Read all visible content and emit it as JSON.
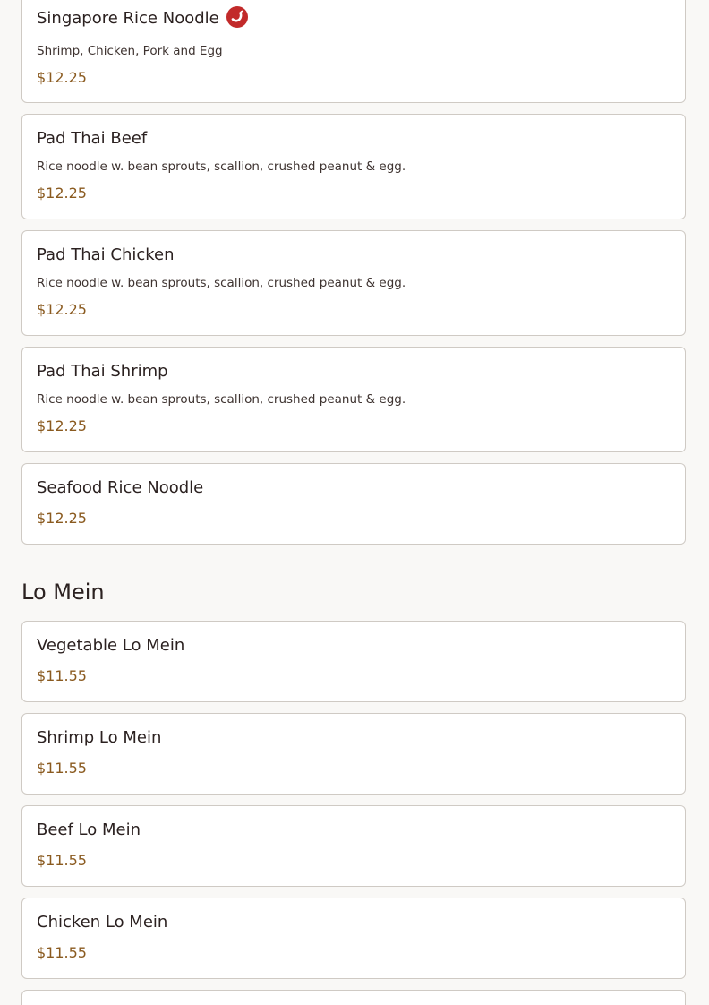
{
  "noodles": {
    "items": [
      {
        "name": "Singapore Rice Noodle",
        "spicy": true,
        "description": "Shrimp, Chicken, Pork and Egg",
        "price": "$12.25"
      },
      {
        "name": "Pad Thai Beef",
        "description": "Rice noodle w. bean sprouts, scallion, crushed peanut & egg.",
        "price": "$12.25"
      },
      {
        "name": "Pad Thai Chicken",
        "description": "Rice noodle w. bean sprouts, scallion, crushed peanut & egg.",
        "price": "$12.25"
      },
      {
        "name": "Pad Thai Shrimp",
        "description": "Rice noodle w. bean sprouts, scallion, crushed peanut & egg.",
        "price": "$12.25"
      },
      {
        "name": "Seafood Rice Noodle",
        "price": "$12.25"
      }
    ]
  },
  "lo_mein": {
    "title": "Lo Mein",
    "items": [
      {
        "name": "Vegetable Lo Mein",
        "price": "$11.55"
      },
      {
        "name": "Shrimp Lo Mein",
        "price": "$11.55"
      },
      {
        "name": "Beef Lo Mein",
        "price": "$11.55"
      },
      {
        "name": "Chicken Lo Mein",
        "price": "$11.55"
      }
    ]
  },
  "icons": {
    "spicy": "chili-pepper-icon"
  },
  "colors": {
    "price": "#8a5a1f",
    "spicy_badge": "#c22a2a",
    "card_border": "#cfcac4",
    "background": "#f9f8f6"
  }
}
